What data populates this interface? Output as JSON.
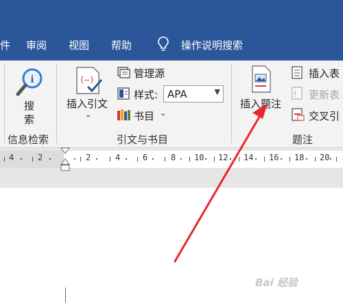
{
  "tabs": [
    {
      "label": "件"
    },
    {
      "label": "审阅"
    },
    {
      "label": "视图"
    },
    {
      "label": "帮助"
    },
    {
      "label": "操作说明搜索"
    }
  ],
  "groups": {
    "research": {
      "search_label_1": "搜",
      "search_label_2": "索",
      "group_label": "信息检索"
    },
    "citations": {
      "insert_citation_label": "插入引文",
      "manage_sources_label": "管理源",
      "style_label": "样式:",
      "style_value": "APA",
      "bibliography_label": "书目",
      "group_label": "引文与书目"
    },
    "captions": {
      "insert_caption_label": "插入题注",
      "insert_table_figures_label": "插入表",
      "update_table_label": "更新表",
      "cross_reference_label": "交叉引",
      "group_label": "题注"
    }
  },
  "ruler": {
    "numbers": [
      "4",
      "2",
      "2",
      "4",
      "6",
      "8",
      "10",
      "12",
      "14",
      "16",
      "18",
      "20"
    ]
  },
  "colors": {
    "ribbon_blue": "#2b579a",
    "annotation_arrow": "#e8262b"
  },
  "watermark": {
    "text": "Bai 经验"
  }
}
